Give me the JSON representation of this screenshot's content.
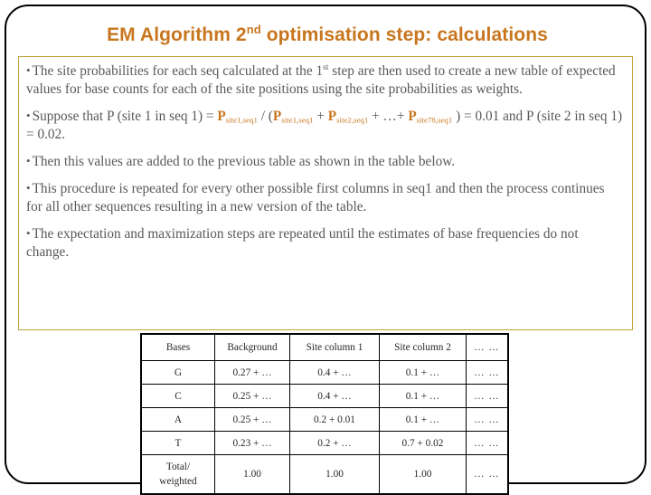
{
  "slide": {
    "title_main_1": "EM Algorithm 2",
    "title_sup": "nd",
    "title_main_2": " optimisation step: calculations",
    "title_color": "#C8761E",
    "body_text_color": "#595959",
    "box_border_color": "#BFA23C",
    "frame_border_color": "#000000"
  },
  "bullets": {
    "b1_part1": "The site probabilities for each seq calculated at the 1",
    "b1_sup": "st",
    "b1_part2": " step are then used to create a new table of expected values for base counts for each of the site positions using the site probabilities as weights.",
    "b2_part1": "Suppose that P (site 1 in seq 1) = ",
    "b2_p1": "P",
    "b2_p1_sub": "site1,seq1",
    "b2_sep1": " / (",
    "b2_p2": "P",
    "b2_p2_sub": "site1,seq1",
    "b2_sep2": " + ",
    "b2_p3": "P",
    "b2_p3_sub": "site2,seq1",
    "b2_sep3": " + …+ ",
    "b2_p4": "P",
    "b2_p4_sub": "site78,seq1",
    "b2_tail": " ) = 0.01 and P (site 2 in seq 1) = 0.02.",
    "b3": "Then this values are added to the previous table as shown in the table below.",
    "b4": "This procedure is repeated for every other possible first columns in seq1 and then the process continues for all other sequences resulting in a new version of the table.",
    "b5": "The expectation and maximization steps are repeated until the estimates of base frequencies  do not change.",
    "marker": "•"
  },
  "table": {
    "headers": [
      "Bases",
      "Background",
      "Site column 1",
      "Site column 2",
      "… …"
    ],
    "rows": [
      {
        "base": "G",
        "background": "0.27 + …",
        "site1": "0.4 + …",
        "site2": "0.1  + …",
        "more": "… …"
      },
      {
        "base": "C",
        "background": "0.25 + …",
        "site1": "0.4 + …",
        "site2": "0.1  + …",
        "more": "… …"
      },
      {
        "base": "A",
        "background": "0.25 + …",
        "site1": "0.2 + 0.01",
        "site2": "0.1  + …",
        "more": "… …"
      },
      {
        "base": "T",
        "background": "0.23 + …",
        "site1": "0.2 + …",
        "site2": "0.7 + 0.02",
        "more": "… …"
      }
    ],
    "total_row": {
      "base_line1": "Total/",
      "base_line2": "weighted",
      "background": "1.00",
      "site1": "1.00",
      "site2": "1.00",
      "more": "… …"
    }
  }
}
